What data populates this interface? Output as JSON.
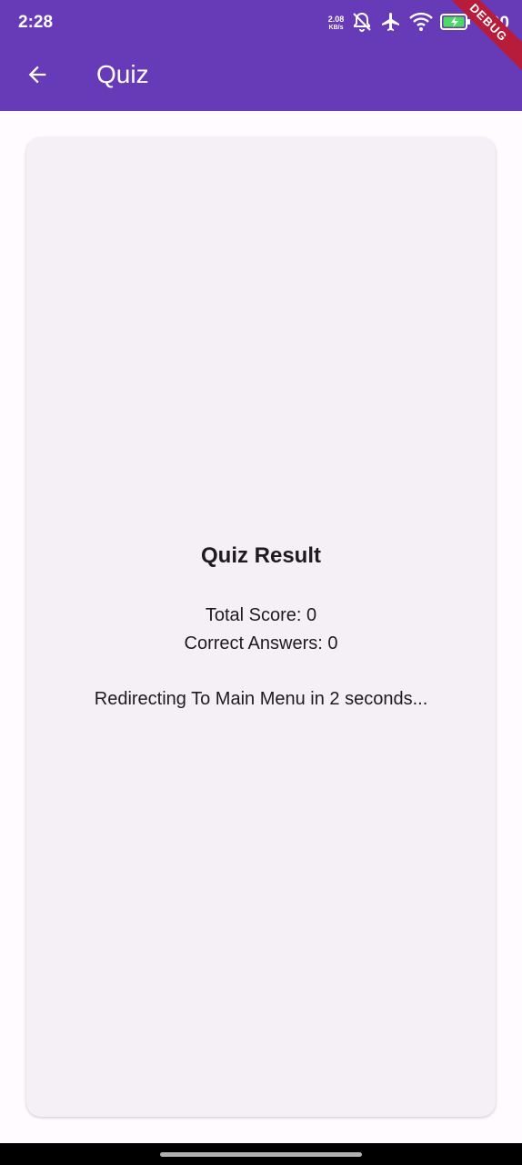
{
  "status_bar": {
    "time": "2:28",
    "net_speed_value": "2.08",
    "net_speed_unit": "KB/s",
    "battery_percent": "100"
  },
  "app_bar": {
    "title": "Quiz",
    "back_icon": "arrow-back-icon",
    "background_color": "#673ab7"
  },
  "debug_banner": {
    "label": "DEBUG"
  },
  "result": {
    "heading": "Quiz Result",
    "total_score": "Total Score: 0",
    "correct_answers": "Correct Answers: 0",
    "redirect_message": "Redirecting To Main Menu in 2 seconds..."
  }
}
